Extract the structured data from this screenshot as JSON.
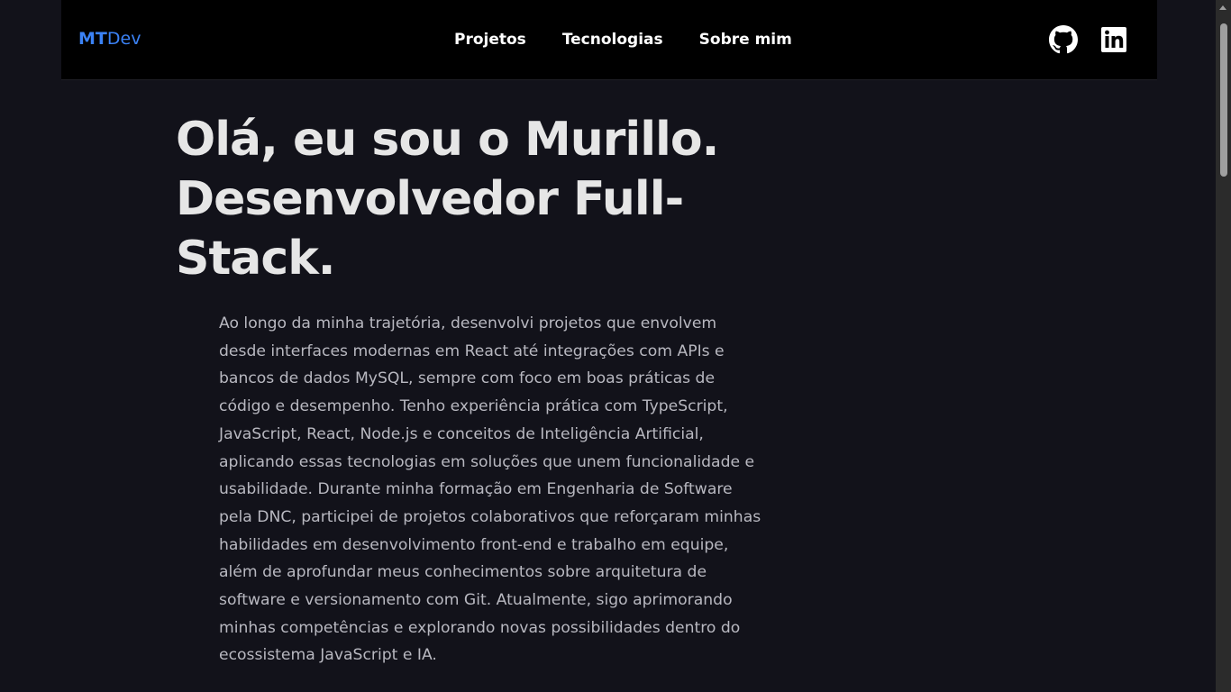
{
  "navbar": {
    "logo_mt": "MT",
    "logo_dev": "Dev",
    "links": [
      {
        "label": "Projetos"
      },
      {
        "label": "Tecnologias"
      },
      {
        "label": "Sobre mim"
      }
    ],
    "social": [
      {
        "icon": "github-icon"
      },
      {
        "icon": "linkedin-icon"
      }
    ]
  },
  "hero": {
    "title": "Olá, eu sou o Murillo. Desenvolvedor Full-Stack.",
    "text": "Ao longo da minha trajetória, desenvolvi projetos que envolvem desde interfaces modernas em React até integrações com APIs e bancos de dados MySQL, sempre com foco em boas práticas de código e desempenho. Tenho experiência prática com TypeScript, JavaScript, React, Node.js e conceitos de Inteligência Artificial, aplicando essas tecnologias em soluções que unem funcionalidade e usabilidade. Durante minha formação em Engenharia de Software pela DNC, participei de projetos colaborativos que reforçaram minhas habilidades em desenvolvimento front-end e trabalho em equipe, além de aprofundar meus conhecimentos sobre arquitetura de software e versionamento com Git. Atualmente, sigo aprimorando minhas competências e explorando novas possibilidades dentro do ecossistema JavaScript e IA."
  },
  "colors": {
    "background": "#12121a",
    "navbar": "#000000",
    "accent": "#3b82f6",
    "title": "#e6e6e6",
    "text": "#b8b8c0"
  }
}
